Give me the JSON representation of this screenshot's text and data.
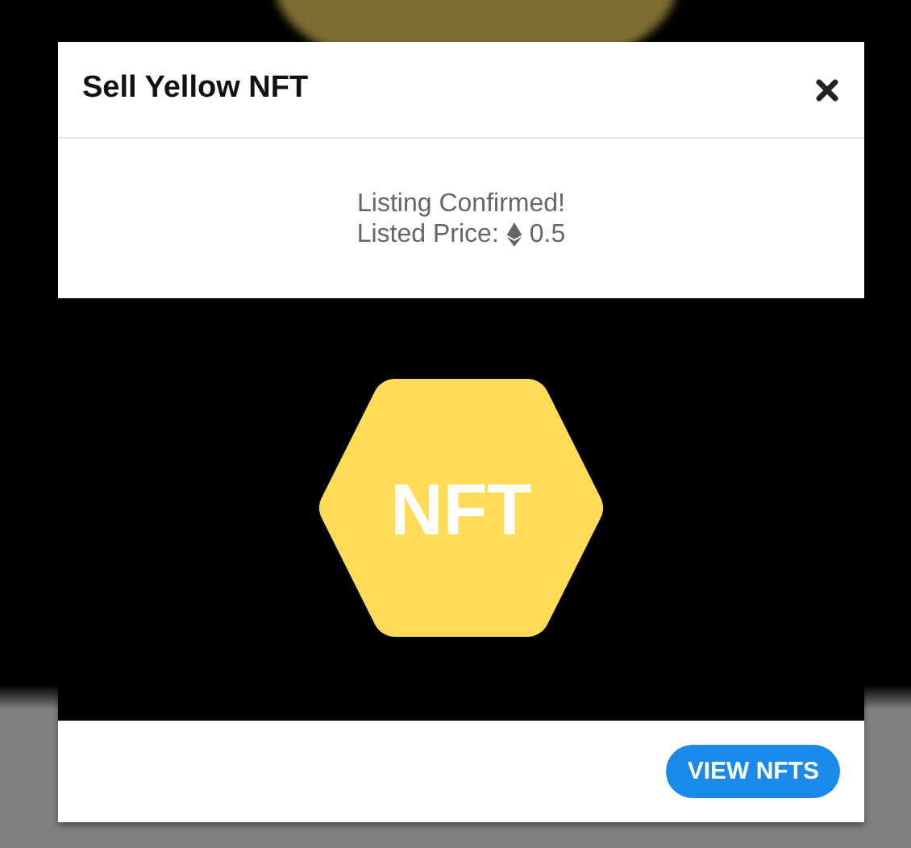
{
  "dialog": {
    "title": "Sell Yellow NFT",
    "message": "Listing Confirmed!",
    "price_label": "Listed Price:",
    "price": "0.5",
    "image": {
      "label": "NFT"
    },
    "buttons": [
      "VIEW NFTS"
    ]
  }
}
